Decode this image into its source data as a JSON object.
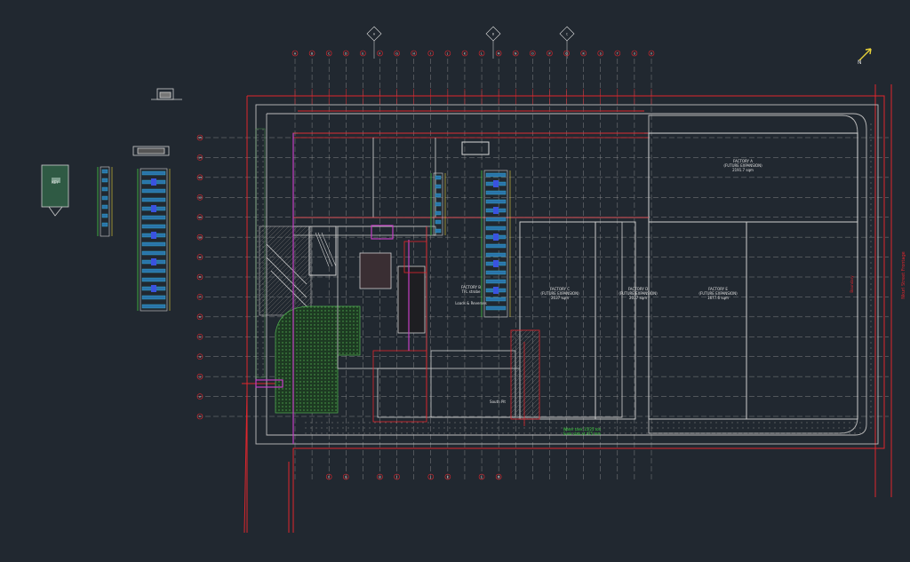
{
  "drawing": {
    "grid_letters_top": [
      "A",
      "B",
      "C",
      "D",
      "E",
      "F",
      "G",
      "H",
      "I",
      "J",
      "K",
      "L",
      "M",
      "N",
      "O",
      "P",
      "Q",
      "R",
      "S",
      "T",
      "U",
      "V"
    ],
    "grid_letters_bottom": [
      "F",
      "G",
      "H",
      "I",
      "J",
      "K",
      "L",
      "M"
    ],
    "grid_numbers": [
      "15",
      "14",
      "13",
      "12",
      "11",
      "10",
      "9",
      "8",
      "7",
      "6",
      "5",
      "4",
      "3",
      "2",
      "1"
    ],
    "sections": [
      "A",
      "B",
      "C"
    ],
    "north_label": "N",
    "factories": [
      {
        "name": "FACTORY A",
        "sub": "(FUTURE EXPANSION)",
        "area": "2191.7 sqm"
      },
      {
        "name": "FACTORY B",
        "sub": "TFL strobe",
        "area": ""
      },
      {
        "name": "FACTORY C",
        "sub": "(FUTURE EXPANSION)",
        "area": "2037 sqm"
      },
      {
        "name": "FACTORY D",
        "sub": "(FUTURE EXPANSION)",
        "area": "2037 sqm"
      },
      {
        "name": "FACTORY E",
        "sub": "(FUTURE EXPANSION)",
        "area": "1677.6 sqm"
      }
    ],
    "labels": {
      "loads": "Loads & Reverses",
      "south_pit": "South Pit",
      "right_street": "Nkurl Street Frontage",
      "green_note_1": "Water tank 15/25 ton",
      "green_note_2": "Sunk slab at 475 mm",
      "boundary_right": "Boundary",
      "legend_box": "KEY"
    },
    "colors": {
      "background": "#212830",
      "grid": "#c8c8c8",
      "red": "#e0262d",
      "magenta": "#c43fc4",
      "green": "#3fa83f",
      "cyan": "#35b6d6",
      "blue": "#3a53e0",
      "yellow": "#e0d83a"
    }
  }
}
